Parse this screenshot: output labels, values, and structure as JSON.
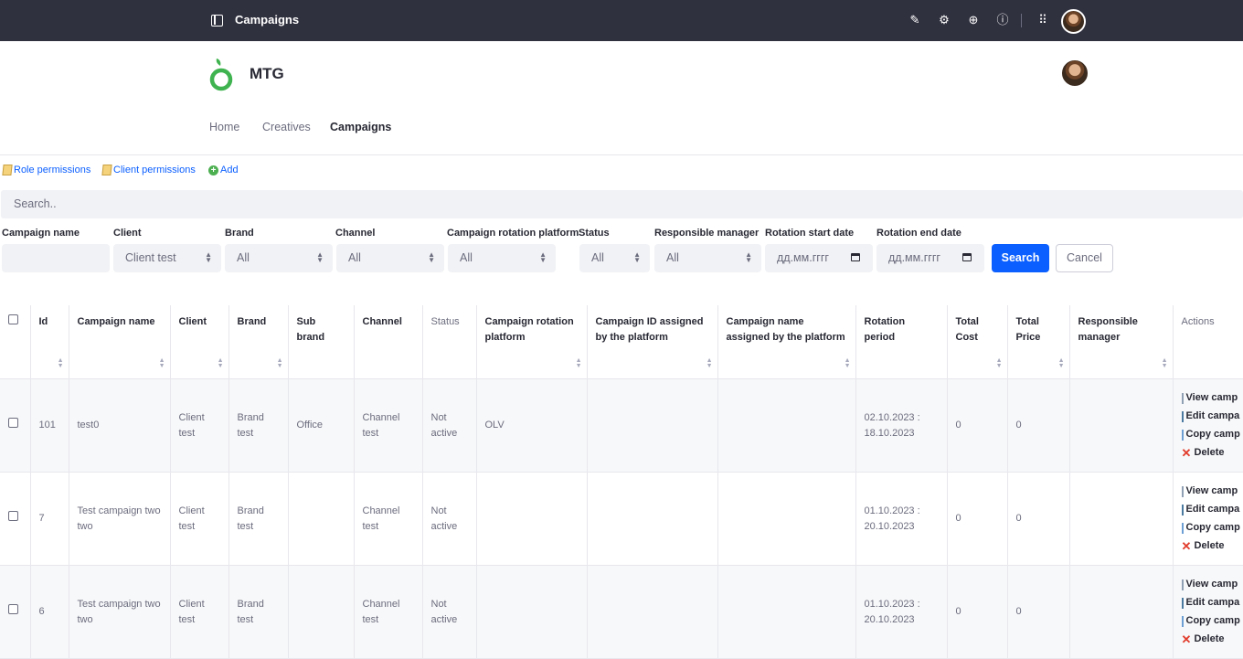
{
  "topbar": {
    "title": "Campaigns"
  },
  "header": {
    "brand": "MTG"
  },
  "nav": [
    "Home",
    "Creatives",
    "Campaigns"
  ],
  "links": {
    "role": "Role permissions",
    "client": "Client permissions",
    "add": "Add"
  },
  "search": {
    "placeholder": "Search.."
  },
  "filters": {
    "labels": {
      "campaign_name": "Campaign name",
      "client": "Client",
      "brand": "Brand",
      "channel": "Channel",
      "platform": "Campaign rotation platform",
      "status": "Status",
      "manager": "Responsible manager",
      "start": "Rotation start date",
      "end": "Rotation end date"
    },
    "values": {
      "campaign_name": "",
      "client": "Client test",
      "brand": "All",
      "channel": "All",
      "platform": "All",
      "status": "All",
      "manager": "All",
      "start": "дд.мм.гггг",
      "end": "дд.мм.гггг"
    },
    "search_button": "Search",
    "cancel_button": "Cancel"
  },
  "table": {
    "headers": [
      "Id",
      "Campaign name",
      "Client",
      "Brand",
      "Sub brand",
      "Channel",
      "Status",
      "Campaign rotation platform",
      "Campaign ID assigned by the platform",
      "Campaign name assigned by the platform",
      "Rotation period",
      "Total Cost",
      "Total Price",
      "Responsible manager",
      "Actions"
    ],
    "rows": [
      {
        "id": "101",
        "name": "test0",
        "client": "Client test",
        "brand": "Brand test",
        "sub_brand": "Office",
        "channel": "Channel test",
        "status": "Not active",
        "platform": "OLV",
        "platform_id": "",
        "platform_name": "",
        "period": "02.10.2023 : 18.10.2023",
        "cost": "0",
        "price": "0",
        "manager": ""
      },
      {
        "id": "7",
        "name": "Test campaign two two",
        "client": "Client test",
        "brand": "Brand test",
        "sub_brand": "",
        "channel": "Channel test",
        "status": "Not active",
        "platform": "",
        "platform_id": "",
        "platform_name": "",
        "period": "01.10.2023 : 20.10.2023",
        "cost": "0",
        "price": "0",
        "manager": ""
      },
      {
        "id": "6",
        "name": "Test campaign two two",
        "client": "Client test",
        "brand": "Brand test",
        "sub_brand": "",
        "channel": "Channel test",
        "status": "Not active",
        "platform": "",
        "platform_id": "",
        "platform_name": "",
        "period": "01.10.2023 : 20.10.2023",
        "cost": "0",
        "price": "0",
        "manager": ""
      }
    ],
    "actions": [
      "View camp",
      "Edit campa",
      "Copy camp",
      "Delete"
    ]
  }
}
